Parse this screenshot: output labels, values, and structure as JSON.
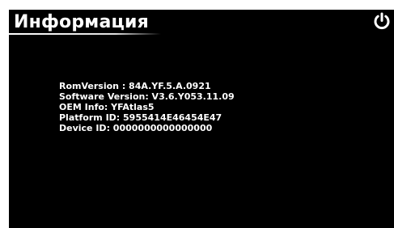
{
  "header": {
    "title": "Информация",
    "power_icon": "power-icon"
  },
  "info": {
    "lines": [
      "RomVersion : 84A.YF.5.A.0921",
      "Software Version: V3.6.Y053.11.09",
      "OEM Info: YFAtlas5",
      "Platform ID: 5955414E46454E47",
      "Device ID: 0000000000000000"
    ]
  },
  "colors": {
    "background": "#000000",
    "text": "#ffffff",
    "page": "#ffffff"
  }
}
